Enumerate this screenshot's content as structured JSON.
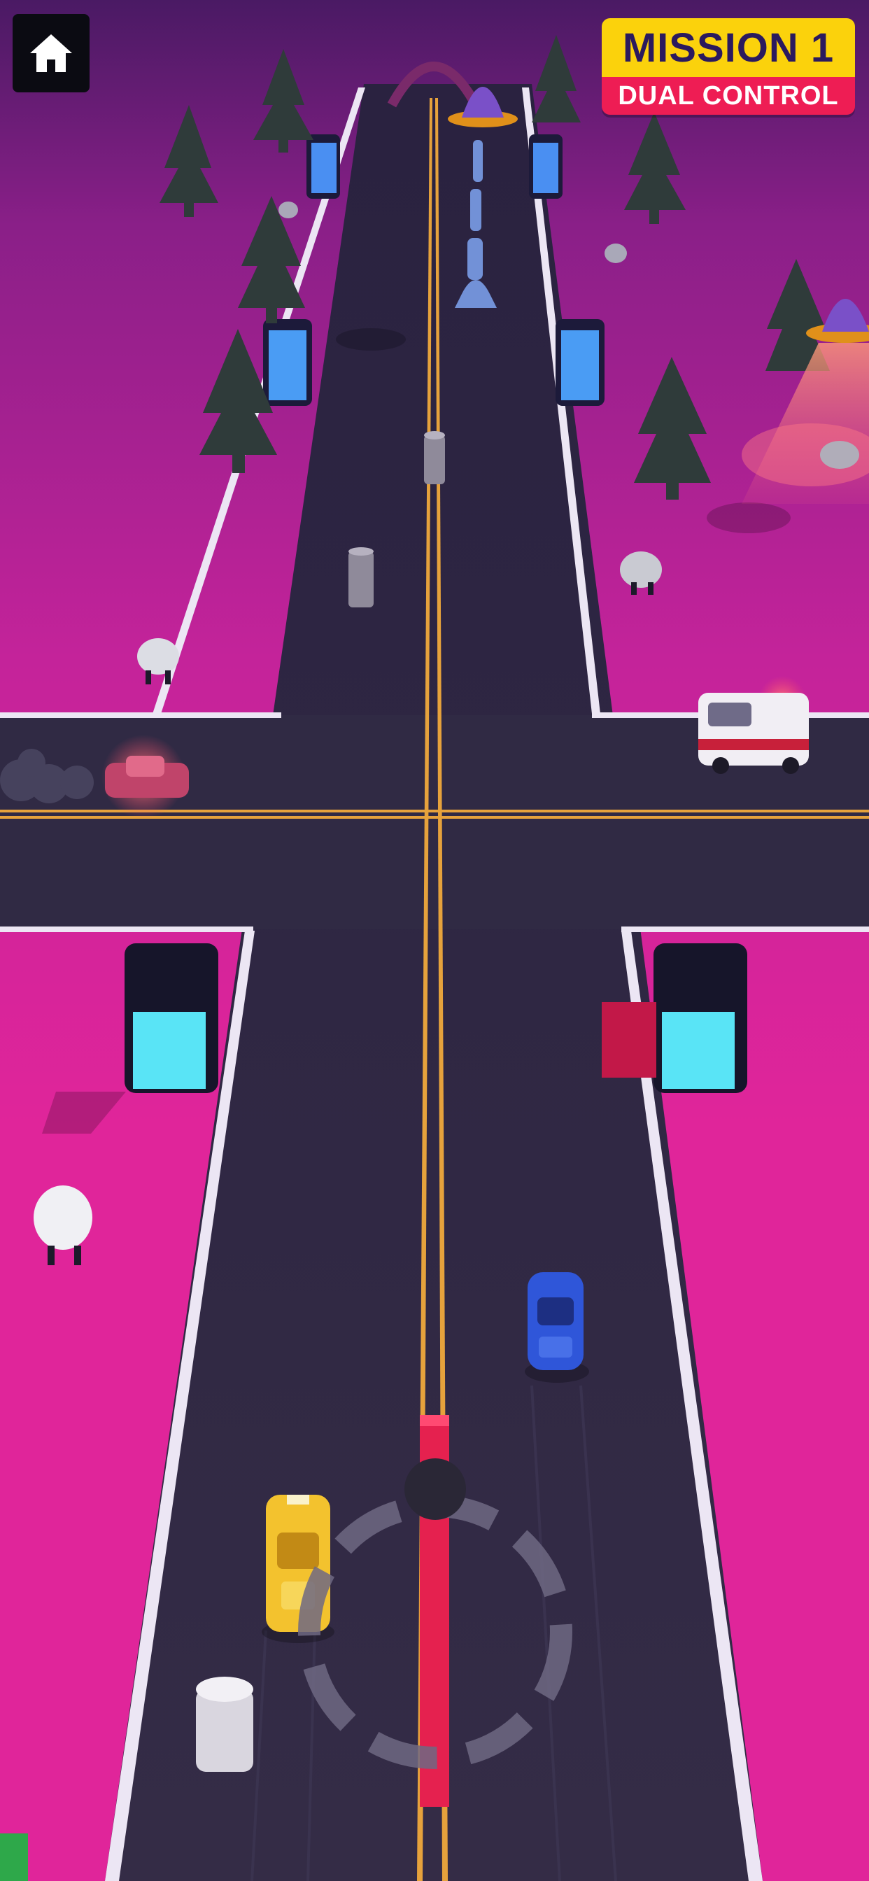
{
  "hud": {
    "home_icon": "home-icon",
    "mission_title": "MISSION 1",
    "mission_subtitle": "DUAL CONTROL"
  },
  "colors": {
    "ground": "#e0259a",
    "ground_far": "#6a1c72",
    "road": "#2f2942",
    "lane_line": "#e6a23c",
    "curb": "#ece6f4",
    "accent_title": "#fbd20c",
    "accent_sub": "#ee1d54",
    "player_car_yellow": "#f3c22e",
    "player_car_blue": "#2f56d9"
  },
  "scene": {
    "objects": [
      "pine-tree",
      "sheep",
      "ufo",
      "portal",
      "bollard",
      "police-car",
      "ambulance",
      "yellow-taxi",
      "blue-sports-car",
      "joystick-ring",
      "lane-divider"
    ]
  }
}
